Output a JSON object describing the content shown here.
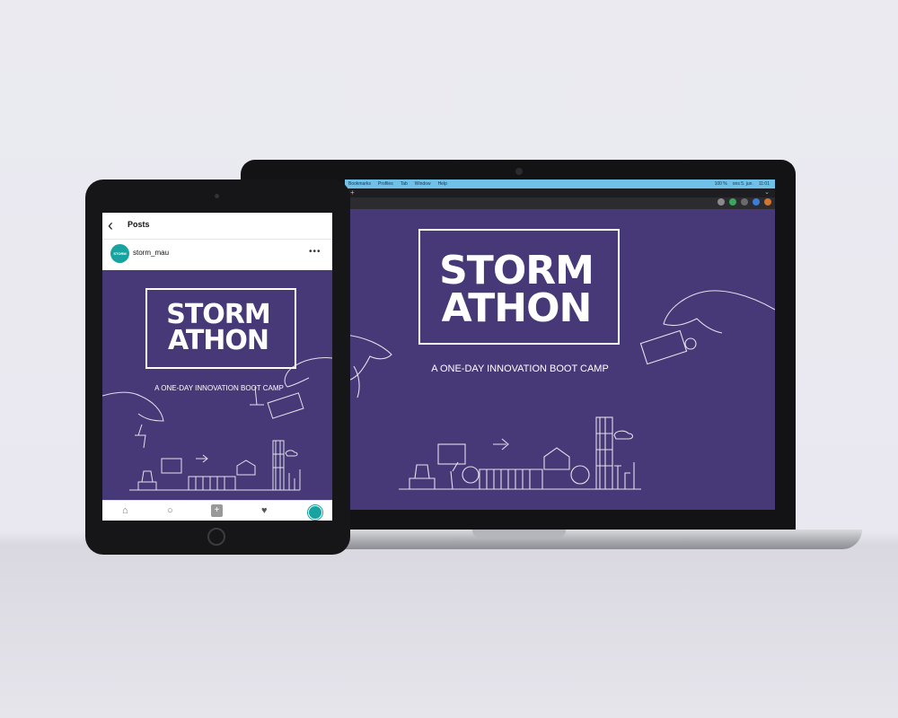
{
  "colors": {
    "background": "#ebeaf1",
    "artwork": "#473878",
    "menubar": "#6fc1e8",
    "instagram_accent": "#17a3a0"
  },
  "laptop": {
    "menubar": {
      "menus": [
        "Bookmarks",
        "Profiles",
        "Tab",
        "Window",
        "Help"
      ],
      "status": [
        "100 %",
        "ons 5. jun.",
        "11:01"
      ]
    },
    "browser": {
      "new_tab_label": "+",
      "window_menu_label": "⌄"
    },
    "slide": {
      "logo_line1": "STORM",
      "logo_line2": "ATHON",
      "tagline": "A ONE-DAY INNOVATION BOOT CAMP"
    }
  },
  "tablet": {
    "header": {
      "back_icon": "chevron-left-icon",
      "title": "Posts"
    },
    "post": {
      "username": "storm_mau",
      "avatar_text": "STORM",
      "more_icon": "more-dots-icon",
      "logo_line1": "STORM",
      "logo_line2": "ATHON",
      "tagline": "A ONE-DAY INNOVATION BOOT CAMP"
    },
    "nav": [
      "home-icon",
      "search-icon",
      "add-post-icon",
      "heart-icon",
      "profile-icon"
    ]
  }
}
